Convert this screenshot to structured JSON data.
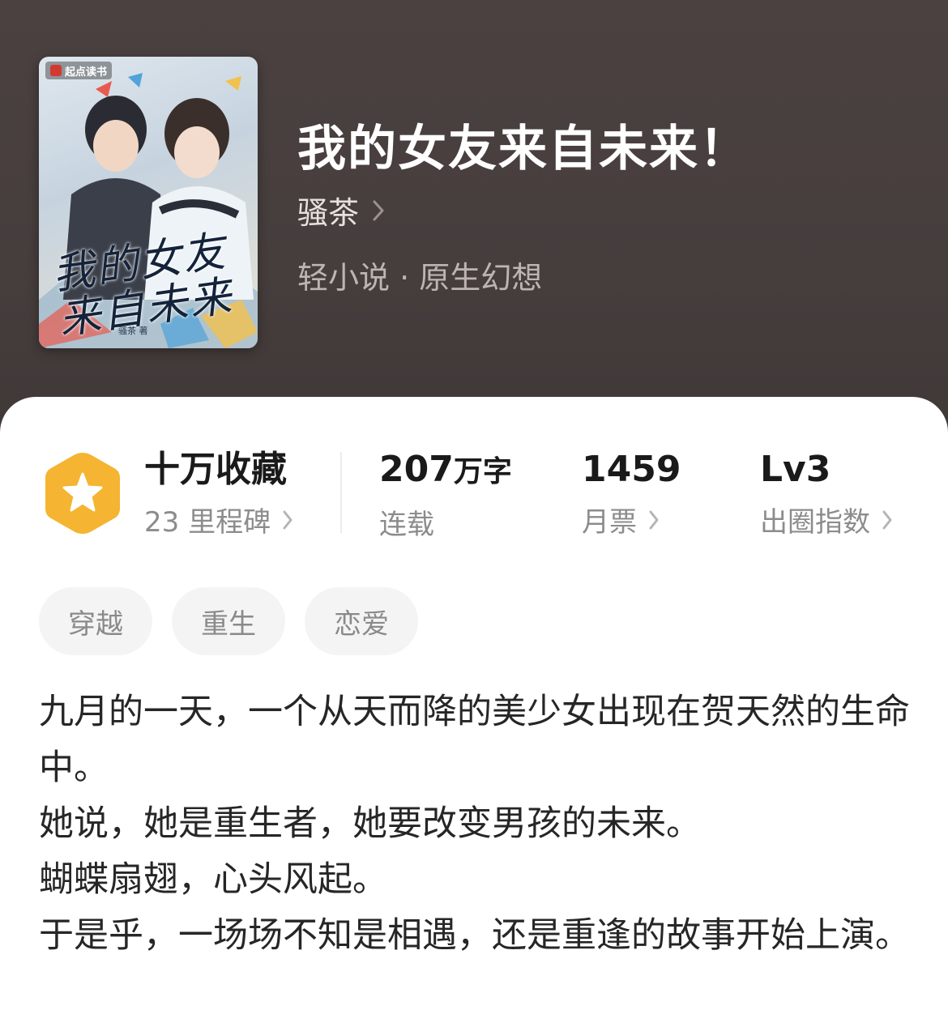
{
  "book": {
    "title": "我的女友来自未来！",
    "author": "骚茶",
    "genre": "轻小说 · 原生幻想"
  },
  "cover": {
    "publisher_label": "起点读书",
    "art_title": "我的女友来自未来",
    "art_author": "骚茶 著"
  },
  "stats": {
    "collection": {
      "value": "十万收藏",
      "label": "23 里程碑"
    },
    "words": {
      "value": "207",
      "unit": "万字",
      "label": "连载"
    },
    "monthly_votes": {
      "value": "1459",
      "label": "月票"
    },
    "influence": {
      "value": "Lv3",
      "label": "出圈指数"
    }
  },
  "tags": [
    "穿越",
    "重生",
    "恋爱"
  ],
  "synopsis": [
    "九月的一天，一个从天而降的美少女出现在贺天然的生命中。",
    "她说，她是重生者，她要改变男孩的未来。",
    "蝴蝶扇翅，心头风起。",
    "于是乎，一场场不知是相遇，还是重逢的故事开始上演。"
  ],
  "colors": {
    "header_bg": "#4a4140",
    "badge": "#f5b431",
    "title": "#ffffff",
    "muted": "#8c8c8c"
  },
  "icons": [
    "chevron-right-icon",
    "star-badge-icon"
  ]
}
